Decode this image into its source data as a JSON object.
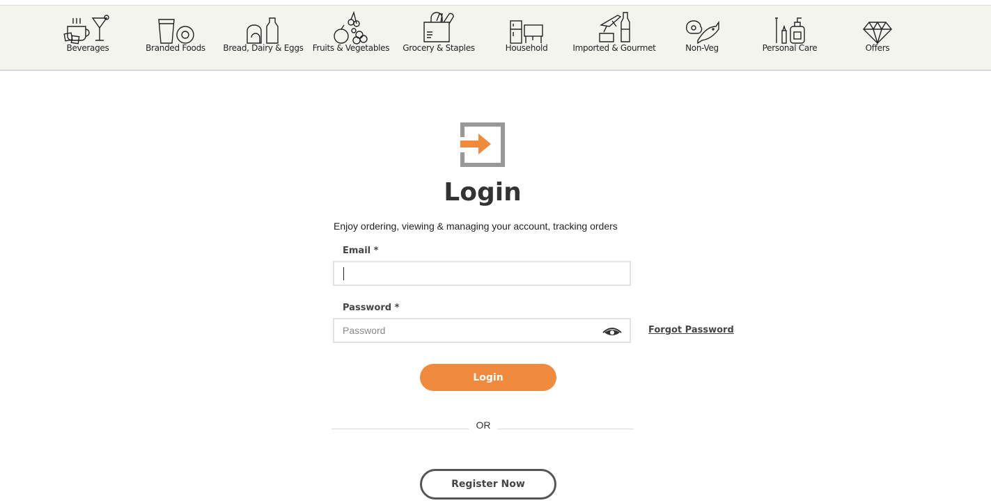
{
  "categories": [
    {
      "label": "Beverages",
      "icon": "beverages-icon"
    },
    {
      "label": "Branded Foods",
      "icon": "branded-foods-icon"
    },
    {
      "label": "Bread, Dairy & Eggs",
      "icon": "bread-dairy-icon"
    },
    {
      "label": "Fruits & Vegetables",
      "icon": "fruits-vegetables-icon"
    },
    {
      "label": "Grocery & Staples",
      "icon": "grocery-bag-icon"
    },
    {
      "label": "Household",
      "icon": "household-appliances-icon"
    },
    {
      "label": "Imported & Gourmet",
      "icon": "imported-gourmet-icon"
    },
    {
      "label": "Non-Veg",
      "icon": "meat-fish-icon"
    },
    {
      "label": "Personal Care",
      "icon": "personal-care-icon"
    },
    {
      "label": "Offers",
      "icon": "diamond-icon"
    }
  ],
  "login": {
    "icon": "login-arrow-icon",
    "title": "Login",
    "subtitle": "Enjoy ordering, viewing & managing your account, tracking orders",
    "email_label": "Email *",
    "email_value": "",
    "password_label": "Password *",
    "password_placeholder": "Password",
    "forgot_label": "Forgot Password",
    "login_button": "Login",
    "or_text": "OR",
    "register_button": "Register Now"
  },
  "colors": {
    "accent": "#f08a3c",
    "category_bar": "#f4f4ef",
    "text_dark": "#333333"
  }
}
